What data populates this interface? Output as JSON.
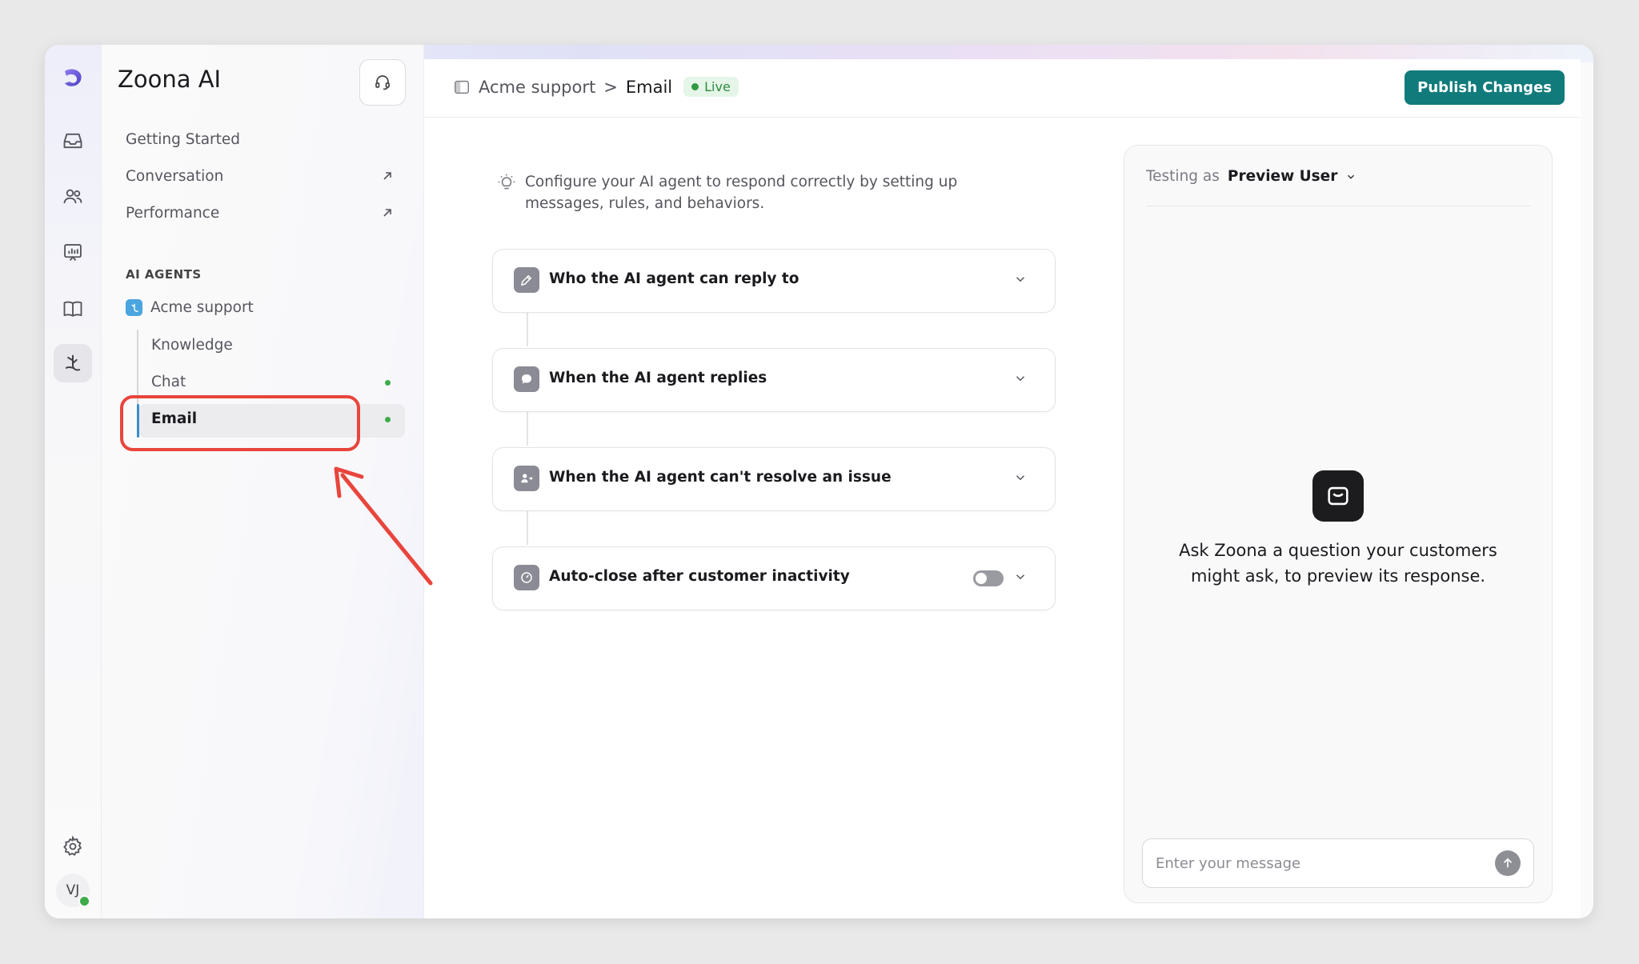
{
  "app": {
    "name": "Zoona AI"
  },
  "nav": [
    {
      "label": "Getting Started",
      "external": false
    },
    {
      "label": "Conversation",
      "external": true
    },
    {
      "label": "Performance",
      "external": true
    }
  ],
  "agents_section": {
    "label": "AI AGENTS",
    "agent": "Acme support",
    "children": [
      {
        "label": "Knowledge",
        "live": false
      },
      {
        "label": "Chat",
        "live": true
      },
      {
        "label": "Email",
        "live": true,
        "selected": true
      }
    ]
  },
  "header": {
    "breadcrumb_parent": "Acme support",
    "breadcrumb_sep": ">",
    "breadcrumb_current": "Email",
    "status": "Live",
    "publish_label": "Publish Changes"
  },
  "intro": "Configure your AI agent to respond correctly by setting up messages, rules, and behaviors.",
  "sections": [
    {
      "title": "Who the AI agent can reply to",
      "icon": "pen-icon"
    },
    {
      "title": "When the AI agent replies",
      "icon": "chat-bubble-icon"
    },
    {
      "title": "When the AI agent can't resolve an issue",
      "icon": "person-handoff-icon"
    },
    {
      "title": "Auto-close after customer inactivity",
      "icon": "timer-icon",
      "toggle": false
    }
  ],
  "preview": {
    "testing_label": "Testing as",
    "user": "Preview User",
    "empty_text": "Ask Zoona a question your customers might ask, to preview its response.",
    "input_placeholder": "Enter your message"
  },
  "user": {
    "initials": "VJ",
    "online": true
  },
  "colors": {
    "accent": "#117b7b",
    "live": "#2f9a42",
    "highlight": "#e8453c"
  }
}
